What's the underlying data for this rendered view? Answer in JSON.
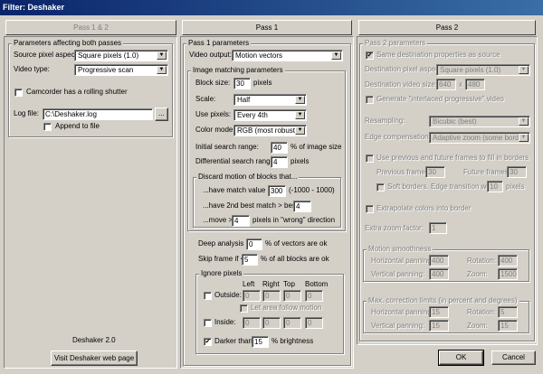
{
  "window": {
    "title": "Filter: Deshaker"
  },
  "tabs": {
    "pass12": "Pass 1 & 2",
    "pass1": "Pass 1",
    "pass2": "Pass 2"
  },
  "left": {
    "group_title": "Parameters affecting both passes",
    "source_pixel_aspect_label": "Source pixel aspect:",
    "source_pixel_aspect_value": "Square pixels  (1.0)",
    "video_type_label": "Video type:",
    "video_type_value": "Progressive scan",
    "rolling_shutter_label": "Camcorder has a rolling shutter",
    "log_file_label": "Log file:",
    "log_file_value": "C:\\Deshaker.log",
    "browse_label": "...",
    "append_label": "Append to file",
    "version": "Deshaker 2.0",
    "web_button": "Visit Deshaker web page"
  },
  "pass1": {
    "group_title": "Pass 1 parameters",
    "video_output_label": "Video output:",
    "video_output_value": "Motion vectors",
    "matching": {
      "title": "Image matching parameters",
      "block_size_label": "Block size:",
      "block_size_value": "30",
      "block_size_unit": "pixels",
      "scale_label": "Scale:",
      "scale_value": "Half",
      "use_pixels_label": "Use pixels:",
      "use_pixels_value": "Every 4th",
      "color_mode_label": "Color mode:",
      "color_mode_value": "RGB  (most robust)",
      "initial_range_label": "Initial search range:",
      "initial_range_value": "40",
      "initial_range_unit": "% of image size",
      "diff_range_label": "Differential search range:",
      "diff_range_value": "4",
      "diff_range_unit": "pixels"
    },
    "discard": {
      "title": "Discard motion of blocks that...",
      "match_label": "...have match value <",
      "match_value": "300",
      "match_range": "(-1000 - 1000)",
      "second_label": "...have 2nd best match > best -",
      "second_value": "4",
      "move_label": "...move >",
      "move_value": "4",
      "move_unit": "pixels in \"wrong\" direction"
    },
    "deep_label": "Deep analysis if <",
    "deep_value": "0",
    "deep_unit": "% of vectors are ok",
    "skip_label": "Skip frame if <",
    "skip_value": "5",
    "skip_unit": "% of all blocks are ok",
    "ignore": {
      "title": "Ignore pixels",
      "outside_label": "Outside:",
      "inside_label": "Inside:",
      "col_left": "Left",
      "col_right": "Right",
      "col_top": "Top",
      "col_bottom": "Bottom",
      "zero": "0",
      "follow_motion_label": "Let area follow motion",
      "darker_label": "Darker than",
      "darker_value": "15",
      "darker_unit": "% brightness"
    }
  },
  "pass2": {
    "group_title": "Pass 2 parameters",
    "same_dest_label": "Same destination properties as source",
    "dest_aspect_label": "Destination pixel aspect:",
    "dest_aspect_value": "Square pixels  (1.0)",
    "dest_size_label": "Destination video size:",
    "dest_w": "640",
    "dest_x": "x",
    "dest_h": "480",
    "interlaced_label": "Generate \"interlaced progressive\" video",
    "resampling_label": "Resampling:",
    "resampling_value": "Bicubic  (best)",
    "edge_comp_label": "Edge compensation:",
    "edge_comp_value": "Adaptive zoom  (some borders)",
    "use_frames_label": "Use previous and future frames to fill in borders",
    "prev_frames_label": "Previous frames:",
    "prev_frames_value": "30",
    "future_frames_label": "Future frames:",
    "future_frames_value": "30",
    "soft_borders_label": "Soft borders. Edge transition width:",
    "soft_borders_value": "10",
    "soft_borders_unit": "pixels",
    "extrapolate_label": "Extrapolate colors into border",
    "extra_zoom_label": "Extra zoom factor:",
    "extra_zoom_value": "1",
    "smooth": {
      "title": "Motion smoothness",
      "hpan_label": "Horizontal panning:",
      "hpan_value": "400",
      "rot_label": "Rotation:",
      "rot_value": "400",
      "vpan_label": "Vertical panning:",
      "vpan_value": "400",
      "zoom_label": "Zoom:",
      "zoom_value": "1500"
    },
    "limits": {
      "title": "Max. correction limits (in percent and degrees)",
      "hpan_label": "Horizontal panning:",
      "hpan_value": "15",
      "rot_label": "Rotation:",
      "rot_value": "5",
      "vpan_label": "Vertical panning:",
      "vpan_value": "15",
      "zoom_label": "Zoom:",
      "zoom_value": "15"
    },
    "ok": "OK",
    "cancel": "Cancel"
  },
  "icons": {
    "dropdown": "▼",
    "check": "✔"
  }
}
